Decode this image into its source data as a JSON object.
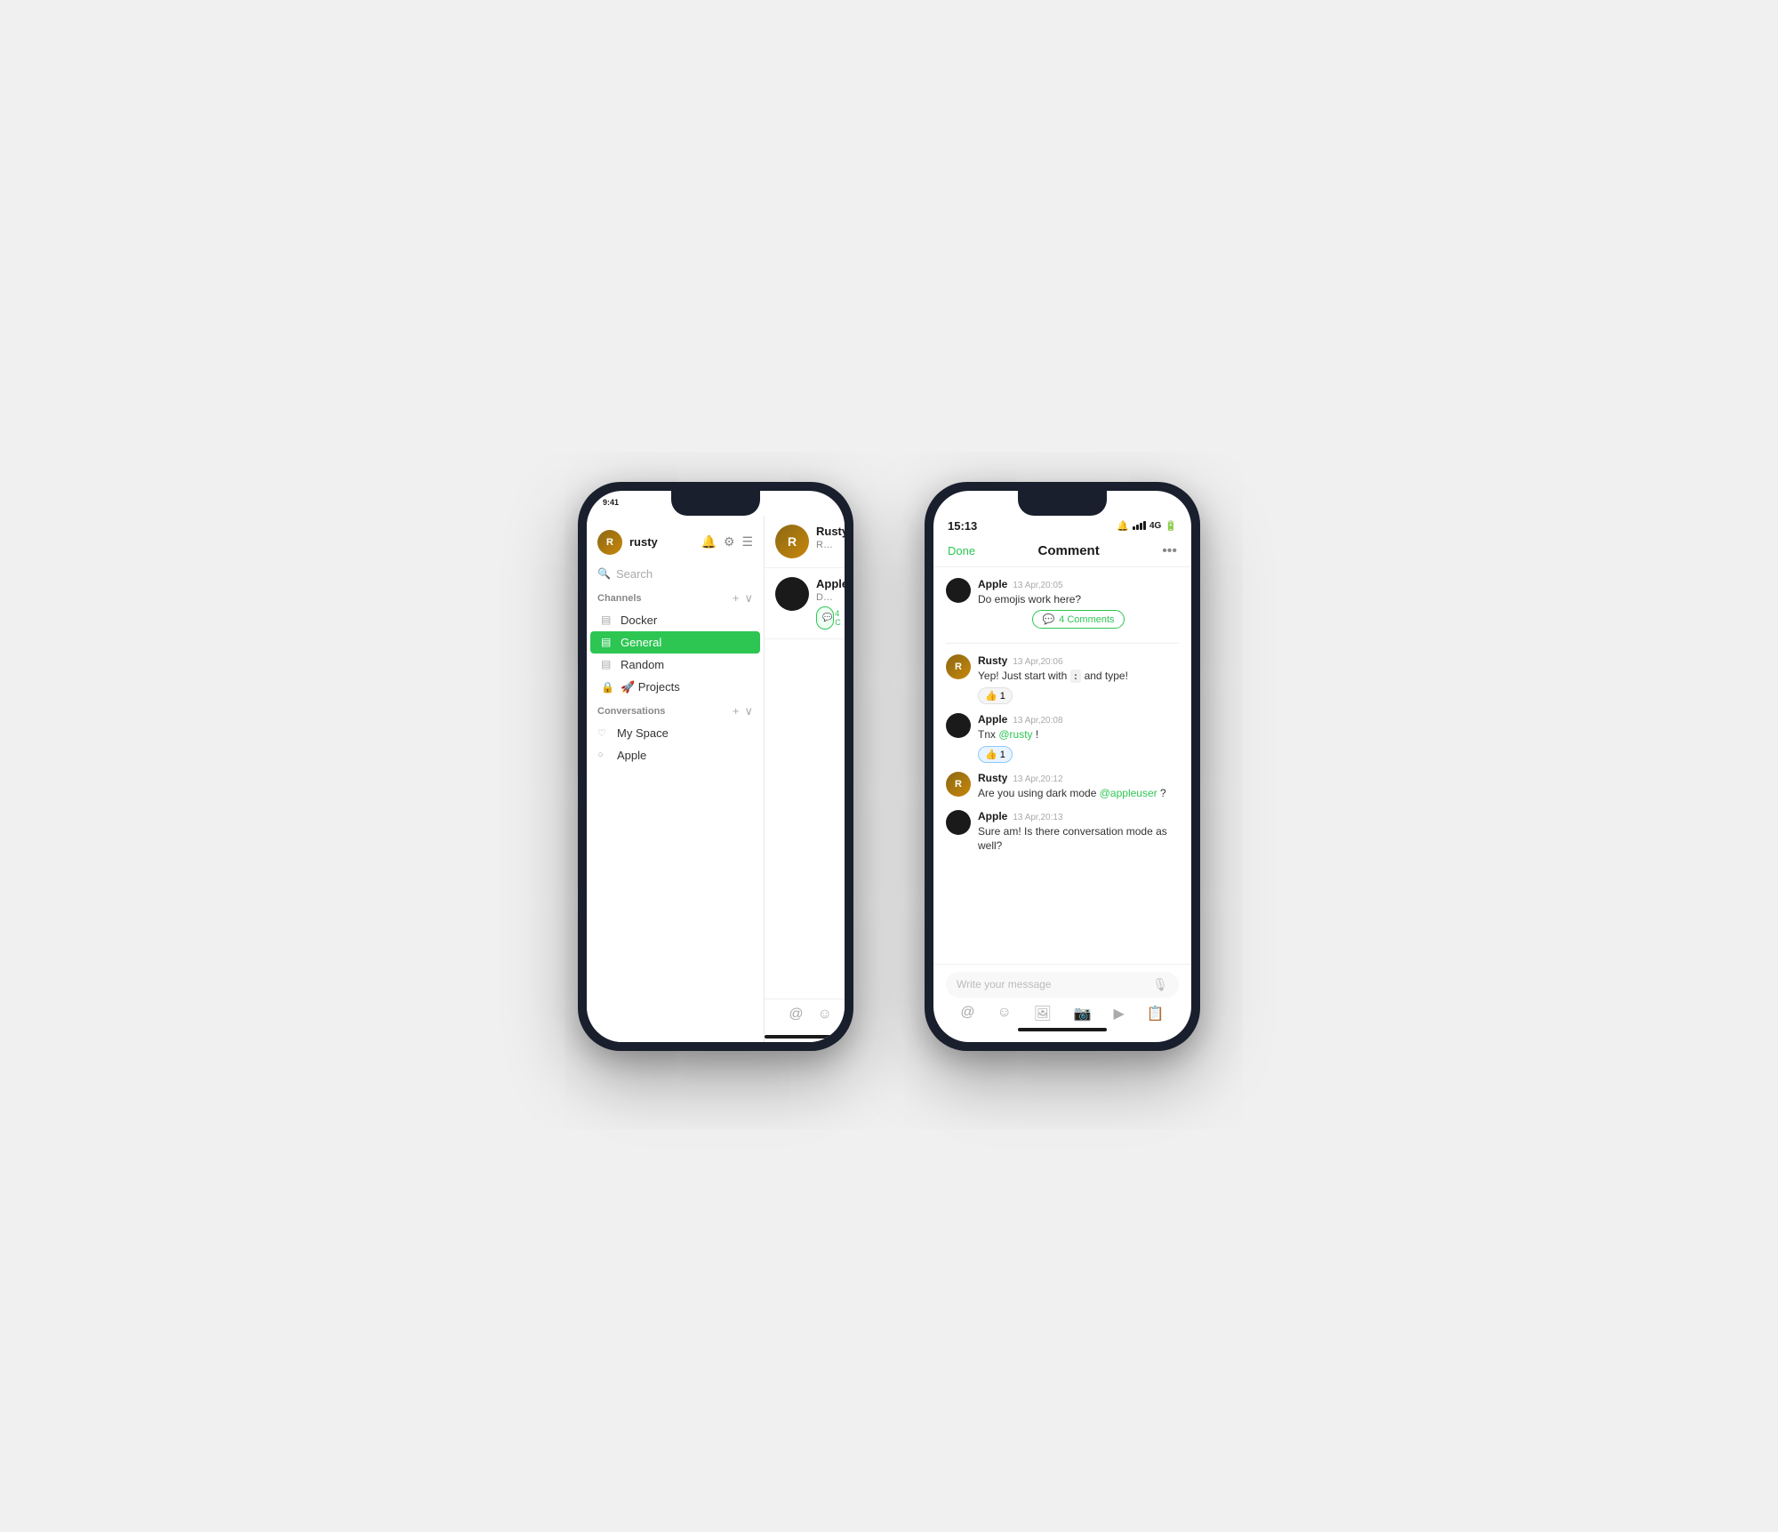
{
  "phone1": {
    "status_time": "9:41",
    "sidebar": {
      "username": "rusty",
      "search_placeholder": "Search",
      "channels_label": "Channels",
      "channels": [
        {
          "name": "Docker",
          "icon": "▤",
          "active": false
        },
        {
          "name": "General",
          "icon": "▤",
          "active": true
        },
        {
          "name": "Random",
          "icon": "▤",
          "active": false
        },
        {
          "name": "🚀 Projects",
          "icon": "🔒",
          "active": false
        }
      ],
      "conversations_label": "Conversations",
      "conversations": [
        {
          "name": "My Space",
          "icon": "♡"
        },
        {
          "name": "Apple",
          "icon": "○"
        }
      ]
    },
    "chat_list": [
      {
        "name": "Rusty",
        "preview": "Rusty...",
        "avatar_type": "rusty"
      },
      {
        "name": "Apple",
        "preview": "Do em...",
        "badge": "4 C",
        "avatar_type": "apple"
      }
    ],
    "toolbar_icons": [
      "@",
      "☺"
    ]
  },
  "phone2": {
    "status_time": "15:13",
    "status_icons": [
      "🔔",
      "4G",
      "🔋"
    ],
    "header": {
      "done_label": "Done",
      "title": "Comment",
      "more_icon": "•••"
    },
    "messages": [
      {
        "author": "Apple",
        "time": "13 Apr,20:05",
        "text": "Do emojis work here?",
        "avatar_type": "apple",
        "comments_count": "4 Comments"
      },
      {
        "author": "Rusty",
        "time": "13 Apr,20:06",
        "text": "Yep! Just start with `:` and type!",
        "avatar_type": "rusty",
        "reaction": "👍 1",
        "reaction_type": "normal"
      },
      {
        "author": "Apple",
        "time": "13 Apr,20:08",
        "text": "Tnx @rusty !",
        "avatar_type": "apple",
        "reaction": "👍 1",
        "reaction_type": "blue"
      },
      {
        "author": "Rusty",
        "time": "13 Apr,20:12",
        "text": "Are you using dark mode @appleuser ?",
        "avatar_type": "rusty",
        "mention": "@appleuser"
      },
      {
        "author": "Apple",
        "time": "13 Apr,20:13",
        "text": "Sure am! Is there conversation mode as well?",
        "avatar_type": "apple"
      }
    ],
    "input_placeholder": "Write your message",
    "toolbar_icons": [
      "@",
      "☺",
      "🖼",
      "📷",
      "▶",
      "📋"
    ]
  }
}
